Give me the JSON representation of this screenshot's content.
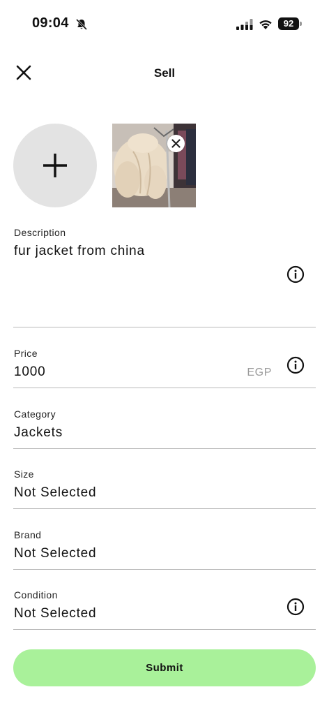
{
  "status_bar": {
    "time": "09:04",
    "battery": "92",
    "icons": [
      "bell-off-icon",
      "signal-icon",
      "wifi-icon",
      "battery-icon"
    ]
  },
  "header": {
    "title": "Sell",
    "close_icon": "close-icon"
  },
  "photos": {
    "add_icon": "plus-icon",
    "remove_icon": "close-icon"
  },
  "form": {
    "description": {
      "label": "Description",
      "value": "fur jacket from china"
    },
    "price": {
      "label": "Price",
      "value": "1000",
      "currency": "EGP"
    },
    "category": {
      "label": "Category",
      "value": "Jackets"
    },
    "size": {
      "label": "Size",
      "value": "Not Selected"
    },
    "brand": {
      "label": "Brand",
      "value": "Not Selected"
    },
    "condition": {
      "label": "Condition",
      "value": "Not Selected"
    }
  },
  "submit_label": "Submit",
  "colors": {
    "submit_bg": "#a9f19a",
    "add_photo_bg": "#e3e3e3",
    "divider": "#b8b8b8"
  }
}
